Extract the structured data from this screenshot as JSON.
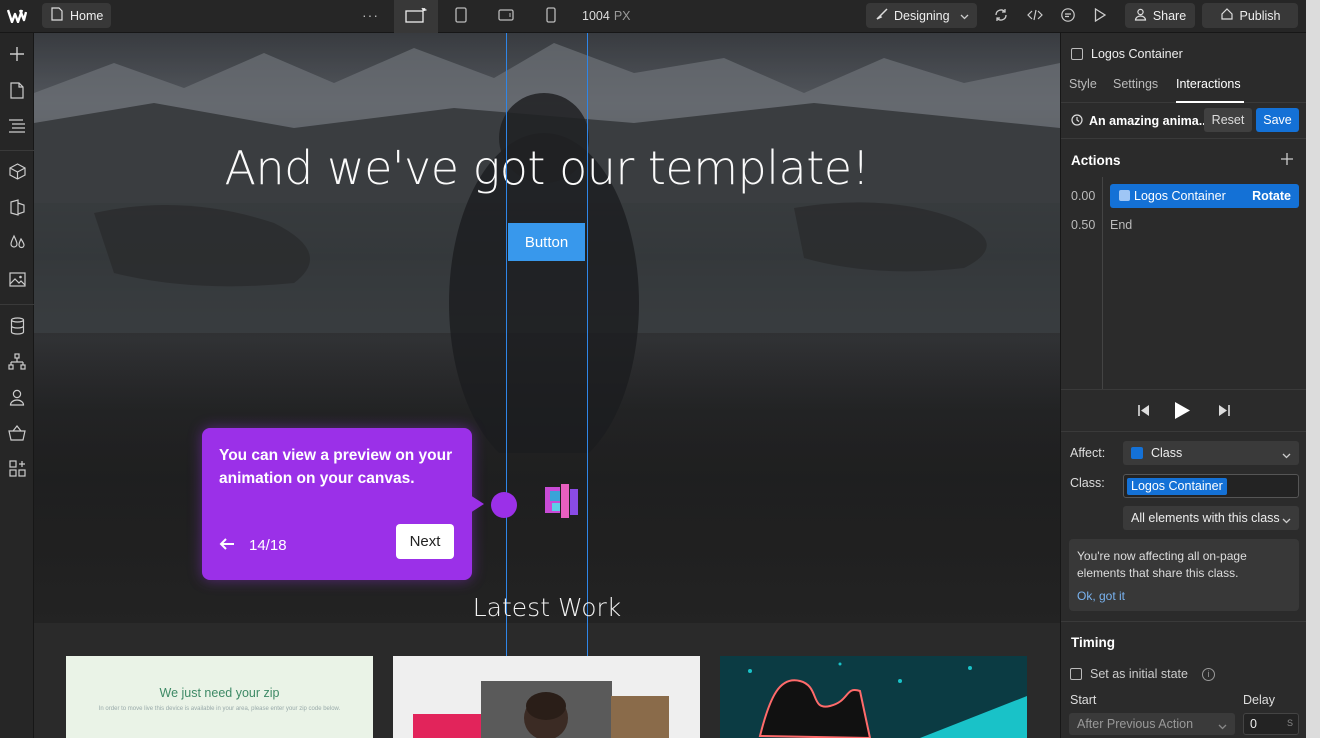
{
  "topbar": {
    "home_label": "Home",
    "more_label": "···",
    "width_value": "1004",
    "width_unit": "PX",
    "mode_label": "Designing",
    "share_label": "Share",
    "publish_label": "Publish"
  },
  "canvas": {
    "hero_title": "And we've got our template!",
    "hero_button": "Button",
    "tour": {
      "text": "You can view a preview on your animation on your canvas.",
      "count": "14/18",
      "next_label": "Next"
    },
    "section_title": "Latest Work",
    "card1_title": "We just need your zip",
    "card1_sub": "In order to move live this device is available in your area, please enter your zip code below."
  },
  "panel": {
    "element_name": "Logos Container",
    "tabs": [
      "Style",
      "Settings",
      "Interactions"
    ],
    "active_tab": "Interactions",
    "animation_name": "An amazing anima...",
    "reset_label": "Reset",
    "save_label": "Save",
    "actions_title": "Actions",
    "actions": [
      {
        "time": "0.00",
        "target": "Logos Container",
        "action": "Rotate"
      },
      {
        "time": "0.50",
        "target": "End"
      }
    ],
    "affect_label": "Affect:",
    "affect_value": "Class",
    "class_label": "Class:",
    "class_value": "Logos Container",
    "scope_value": "All elements with this class",
    "info_text": "You're now affecting all on-page elements that share this class.",
    "info_ok": "Ok, got it",
    "timing_title": "Timing",
    "initial_state_label": "Set as initial state",
    "start_label": "Start",
    "delay_label": "Delay",
    "start_value": "After Previous Action",
    "delay_value": "0",
    "delay_unit": "S"
  },
  "colors": {
    "accent": "#1471d6",
    "tour": "#9b30e8",
    "hero_button": "#3898ec"
  }
}
